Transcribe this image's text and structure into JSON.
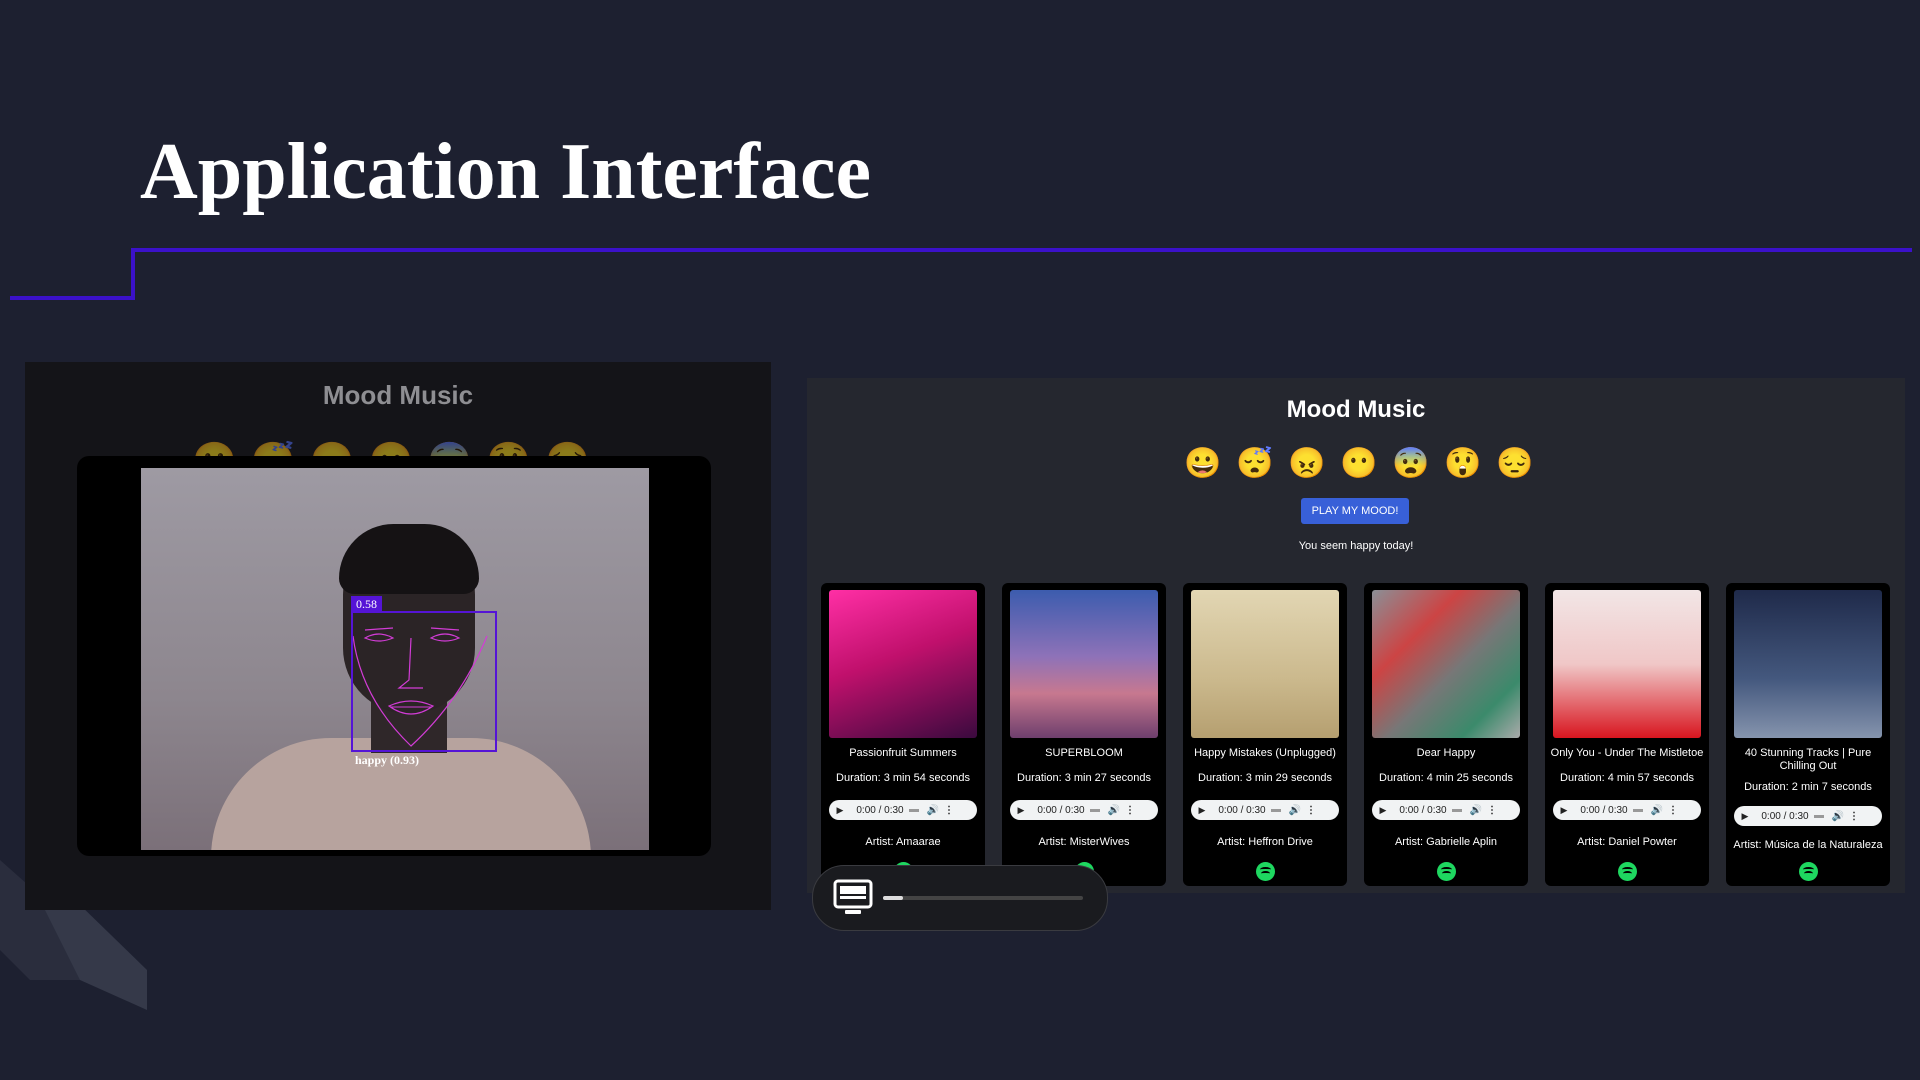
{
  "slide": {
    "title": "Application Interface",
    "accent_color": "#3b11c9"
  },
  "detection_panel": {
    "title": "Mood Music",
    "emojis": [
      "😀",
      "😴",
      "😠",
      "😶",
      "😨",
      "😲",
      "😔"
    ],
    "face_score": "0.58",
    "face_label": "happy (0.93)"
  },
  "app": {
    "title": "Mood Music",
    "emojis": [
      {
        "icon": "grinning-face-icon",
        "char": "😀"
      },
      {
        "icon": "sleeping-face-icon",
        "char": "😴"
      },
      {
        "icon": "angry-face-icon",
        "char": "😠"
      },
      {
        "icon": "neutral-face-icon",
        "char": "😶"
      },
      {
        "icon": "fearful-face-icon",
        "char": "😨"
      },
      {
        "icon": "astonished-face-icon",
        "char": "😲"
      },
      {
        "icon": "pensive-face-icon",
        "char": "😔"
      }
    ],
    "play_button": "PLAY MY MOOD!",
    "status": "You seem happy today!",
    "play_button_color": "#3860d8",
    "spotify_icon": "spotify-icon",
    "tracks": [
      {
        "title": "Passionfruit Summers",
        "duration": "Duration: 3 min 54 seconds",
        "time": "0:00 / 0:30",
        "artist": "Artist: Amaarae",
        "art": "linear-gradient(160deg,#ff2fa5 0%,#c0106c 45%,#3a0a3e 100%)"
      },
      {
        "title": "SUPERBLOOM",
        "duration": "Duration: 3 min 27 seconds",
        "time": "0:00 / 0:30",
        "artist": "Artist: MisterWives",
        "art": "linear-gradient(180deg,#3c5cae 0%,#8e72b8 45%,#c7788f 70%,#6e3f6d 100%)"
      },
      {
        "title": "Happy Mistakes (Unplugged)",
        "duration": "Duration: 3 min 29 seconds",
        "time": "0:00 / 0:30",
        "artist": "Artist: Heffron Drive",
        "art": "linear-gradient(180deg,#e2d6b3 0%,#cbb98d 60%,#b59f70 100%)"
      },
      {
        "title": "Dear Happy",
        "duration": "Duration: 4 min 25 seconds",
        "time": "0:00 / 0:30",
        "artist": "Artist: Gabrielle Aplin",
        "art": "linear-gradient(135deg,#8a8f96 0%,#c44 30%,#777 55%,#3b8a6b 80%,#aaa 100%)"
      },
      {
        "title": "Only You - Under The Mistletoe",
        "duration": "Duration: 4 min 57 seconds",
        "time": "0:00 / 0:30",
        "artist": "Artist: Daniel Powter",
        "art": "linear-gradient(180deg,#f2e6e6 0%,#f0c7c7 50%,#d8151f 100%)"
      },
      {
        "title": "40 Stunning Tracks | Pure Chilling Out",
        "duration": "Duration: 2 min 7 seconds",
        "time": "0:00 / 0:30",
        "artist": "Artist: Música de la Naturaleza",
        "art": "linear-gradient(180deg,#1f2a4a 0%,#44587e 60%,#8594ad 100%)"
      }
    ]
  },
  "share_bar": {
    "icon": "screen-share-icon",
    "progress": 0.1
  }
}
